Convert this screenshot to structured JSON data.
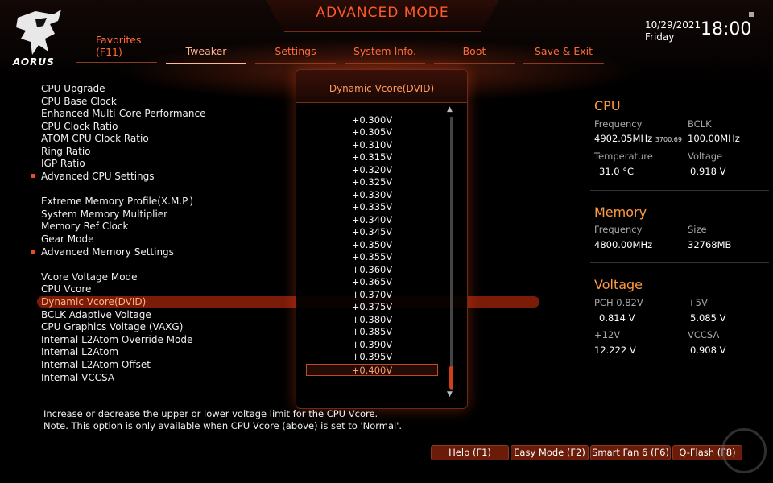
{
  "header": {
    "title": "ADVANCED MODE",
    "brand": "AORUS",
    "date": "10/29/2021",
    "day": "Friday",
    "time": "18:00"
  },
  "tabs": [
    {
      "label": "Favorites",
      "key": "(F11)"
    },
    {
      "label": "Tweaker",
      "active": true
    },
    {
      "label": "Settings"
    },
    {
      "label": "System Info."
    },
    {
      "label": "Boot"
    },
    {
      "label": "Save & Exit"
    }
  ],
  "menu": {
    "items": [
      "CPU Upgrade",
      "CPU Base Clock",
      "Enhanced Multi-Core Performance",
      "CPU Clock Ratio",
      "ATOM CPU Clock Ratio",
      "Ring Ratio",
      "IGP Ratio",
      "Advanced CPU Settings",
      "Extreme Memory Profile(X.M.P.)",
      "System Memory Multiplier",
      "Memory Ref Clock",
      "Gear Mode",
      "Advanced Memory Settings",
      "Vcore Voltage Mode",
      "CPU Vcore",
      "Dynamic Vcore(DVID)",
      "BCLK Adaptive Voltage",
      "CPU Graphics Voltage (VAXG)",
      "Internal L2Atom Override Mode",
      "Internal L2Atom",
      "Internal L2Atom Offset",
      "Internal VCCSA"
    ]
  },
  "popup": {
    "title": "Dynamic Vcore(DVID)",
    "options": [
      "+0.300V",
      "+0.305V",
      "+0.310V",
      "+0.315V",
      "+0.320V",
      "+0.325V",
      "+0.330V",
      "+0.335V",
      "+0.340V",
      "+0.345V",
      "+0.350V",
      "+0.355V",
      "+0.360V",
      "+0.365V",
      "+0.370V",
      "+0.375V",
      "+0.380V",
      "+0.385V",
      "+0.390V",
      "+0.395V",
      "+0.400V"
    ],
    "selected": "+0.400V"
  },
  "cpu": {
    "heading": "CPU",
    "freq_label": "Frequency",
    "freq_value": "4902.05MHz",
    "freq_sub": "3700.69",
    "bclk_label": "BCLK",
    "bclk_value": "100.00MHz",
    "temp_label": "Temperature",
    "temp_value": "31.0 °C",
    "volt_label": "Voltage",
    "volt_value": "0.918 V"
  },
  "memory": {
    "heading": "Memory",
    "freq_label": "Frequency",
    "freq_value": "4800.00MHz",
    "size_label": "Size",
    "size_value": "32768MB"
  },
  "voltage": {
    "heading": "Voltage",
    "pch_label": "PCH 0.82V",
    "pch_value": "0.814 V",
    "p5_label": "+5V",
    "p5_value": "5.085 V",
    "p12_label": "+12V",
    "p12_value": "12.222 V",
    "vccsa_label": "VCCSA",
    "vccsa_value": "0.908 V"
  },
  "help": {
    "line1": "Increase or decrease the upper or lower voltage limit for the CPU Vcore.",
    "line2": "Note. This option is only available when CPU Vcore (above) is set to 'Normal'."
  },
  "footer": {
    "help": "Help (F1)",
    "easy": "Easy Mode (F2)",
    "fan": "Smart Fan 6 (F6)",
    "qflash": "Q-Flash (F8)"
  },
  "colors": {
    "accent": "#ff5a2a",
    "selection": "#7a1c08",
    "heading": "#ff9a40"
  }
}
